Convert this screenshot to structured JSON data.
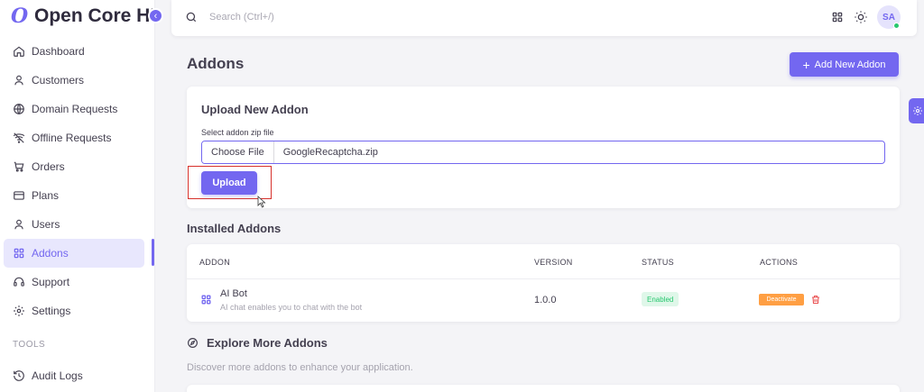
{
  "brand": {
    "logo": "O",
    "name": "Open Core HR",
    "collapse_icon": "chevron-left-icon"
  },
  "sidebar": {
    "items": [
      {
        "label": "Dashboard",
        "icon": "home-icon"
      },
      {
        "label": "Customers",
        "icon": "user-icon"
      },
      {
        "label": "Domain Requests",
        "icon": "globe-icon"
      },
      {
        "label": "Offline Requests",
        "icon": "wifi-off-icon"
      },
      {
        "label": "Orders",
        "icon": "cart-icon"
      },
      {
        "label": "Plans",
        "icon": "credit-card-icon"
      },
      {
        "label": "Users",
        "icon": "user-icon"
      },
      {
        "label": "Addons",
        "icon": "apps-icon",
        "active": true
      },
      {
        "label": "Support",
        "icon": "headset-icon"
      },
      {
        "label": "Settings",
        "icon": "gear-icon"
      }
    ],
    "section_label": "TOOLS",
    "tools_items": [
      {
        "label": "Audit Logs",
        "icon": "history-icon"
      }
    ]
  },
  "topbar": {
    "search_placeholder": "Search (Ctrl+/)",
    "avatar_initials": "SA"
  },
  "page": {
    "title": "Addons",
    "add_button": "Add New Addon"
  },
  "upload": {
    "title": "Upload New Addon",
    "field_label": "Select addon zip file",
    "choose_label": "Choose File",
    "file_name": "GoogleRecaptcha.zip",
    "upload_button": "Upload"
  },
  "installed": {
    "title": "Installed Addons",
    "columns": [
      "ADDON",
      "VERSION",
      "STATUS",
      "ACTIONS"
    ],
    "rows": [
      {
        "name": "AI Bot",
        "description": "AI chat enables you to chat with the bot",
        "version": "1.0.0",
        "status": "Enabled",
        "action": "Deactivate"
      }
    ]
  },
  "explore": {
    "title": "Explore More Addons",
    "description": "Discover more addons to enhance your application."
  },
  "colors": {
    "primary": "#7367f0",
    "success": "#28c76f",
    "warning": "#ff9f43",
    "danger": "#ea5455",
    "highlight": "#d6312b"
  }
}
